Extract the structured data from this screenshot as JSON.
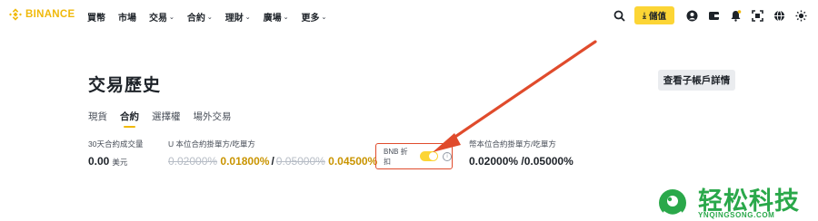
{
  "brand": {
    "name": "BINANCE",
    "accent": "#f0b90b"
  },
  "nav": {
    "items": [
      {
        "label": "買幣",
        "has_dropdown": false
      },
      {
        "label": "市場",
        "has_dropdown": false
      },
      {
        "label": "交易",
        "has_dropdown": true
      },
      {
        "label": "合約",
        "has_dropdown": true
      },
      {
        "label": "理財",
        "has_dropdown": true
      },
      {
        "label": "廣場",
        "has_dropdown": true
      },
      {
        "label": "更多",
        "has_dropdown": true
      }
    ],
    "deposit_label": "儲值",
    "icons": [
      "search-icon",
      "user-icon",
      "wallet-icon",
      "bell-icon",
      "download-app-icon",
      "globe-icon",
      "theme-icon"
    ]
  },
  "page": {
    "title": "交易歷史",
    "subaccount_button": "查看子帳戶詳情",
    "tabs": [
      {
        "label": "現貨",
        "active": false
      },
      {
        "label": "合約",
        "active": true
      },
      {
        "label": "選擇權",
        "active": false
      },
      {
        "label": "場外交易",
        "active": false
      }
    ]
  },
  "stats": {
    "volume": {
      "label": "30天合約成交量",
      "value": "0.00",
      "unit": "美元"
    },
    "usdm": {
      "label": "U 本位合約掛單方/吃單方",
      "maker_old": "0.02000%",
      "maker_new": "0.01800%",
      "slash": "/",
      "taker_old": "0.05000%",
      "taker_new": "0.04500%"
    },
    "bnb": {
      "label": "BNB 折扣",
      "enabled": true,
      "info": "i"
    },
    "coinm": {
      "label": "幣本位合約掛單方/吃單方",
      "value": "0.02000% /0.05000%"
    }
  },
  "watermark": {
    "text": "轻松科技",
    "url": "YNQINGSONG.COM"
  },
  "colors": {
    "annotation": "#e04b2c",
    "watermark": "#2aa84a",
    "toggle_on": "#fcd535"
  }
}
